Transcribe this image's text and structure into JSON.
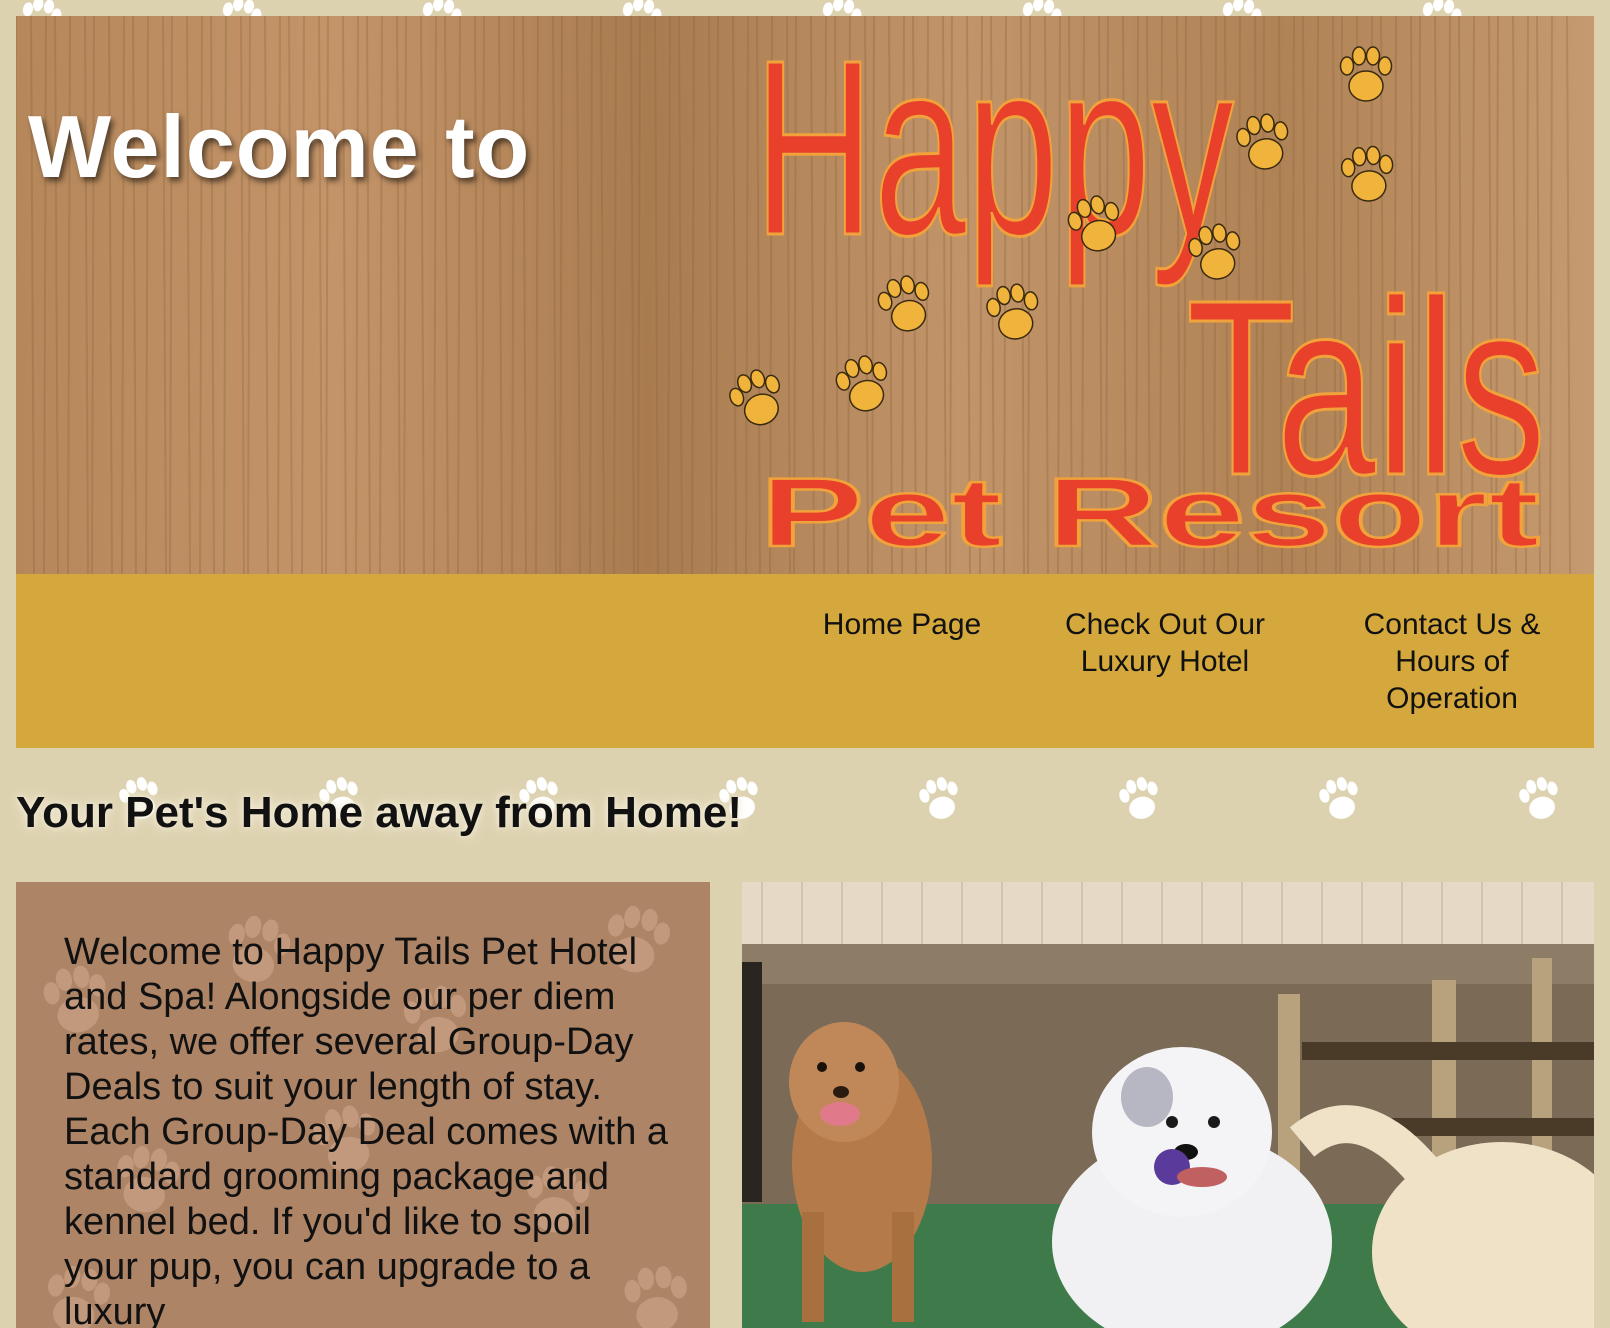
{
  "header": {
    "welcome": "Welcome to",
    "logo_line1": "Happy",
    "logo_line2": "Tails",
    "logo_line3": "Pet Resort"
  },
  "nav": {
    "items": [
      {
        "label_lines": [
          "Home Page"
        ]
      },
      {
        "label_lines": [
          "Check Out Our",
          "Luxury Hotel"
        ]
      },
      {
        "label_lines": [
          "Contact Us &",
          "Hours of",
          "Operation"
        ]
      }
    ]
  },
  "main": {
    "headline": "Your Pet's Home away from Home!",
    "intro_text": "Welcome to Happy Tails Pet Hotel and Spa! Alongside our per diem rates, we offer several Group-Day Deals to suit your length of stay. Each Group-Day Deal comes with a standard grooming package and kennel bed. If you'd like to spoil your pup, you can upgrade to a luxury"
  },
  "colors": {
    "page_bg": "#ddd2b0",
    "nav_bg": "#d4a83c",
    "intro_bg": "#ae8466",
    "logo_red": "#e8402a",
    "paw_gold": "#f0b43c"
  },
  "icons": {
    "paw": "paw-print-icon"
  }
}
